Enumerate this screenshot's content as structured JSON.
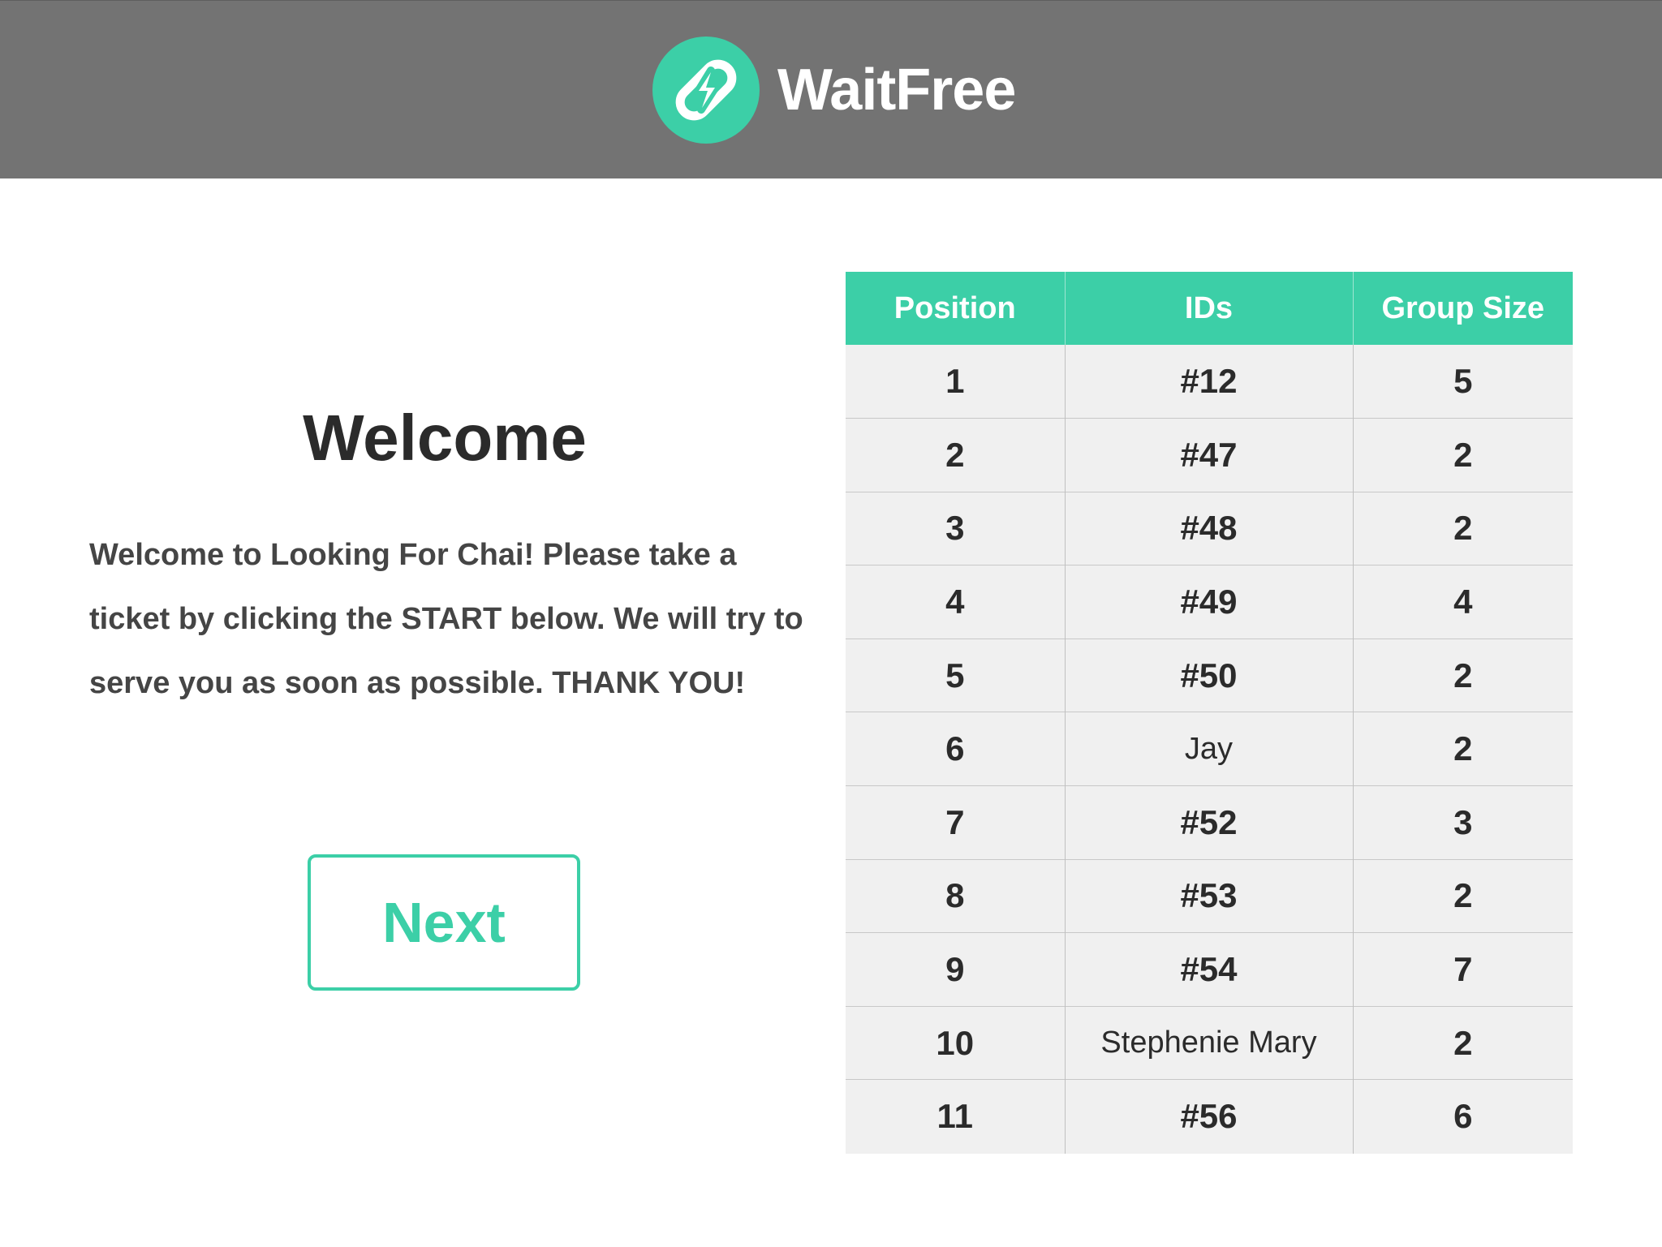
{
  "header": {
    "brand_name": "WaitFree",
    "logo_icon": "link-bolt-icon",
    "accent_color": "#3ccfa7",
    "background_color": "#737373"
  },
  "welcome": {
    "title": "Welcome",
    "message": "Welcome to Looking For Chai! Please take a ticket by clicking the START below. We will try to serve you as soon as possible. THANK YOU!",
    "next_label": "Next"
  },
  "queue": {
    "columns": [
      "Position",
      "IDs",
      "Group Size"
    ],
    "rows": [
      {
        "position": "1",
        "id": "#12",
        "group_size": "5"
      },
      {
        "position": "2",
        "id": "#47",
        "group_size": "2"
      },
      {
        "position": "3",
        "id": "#48",
        "group_size": "2"
      },
      {
        "position": "4",
        "id": "#49",
        "group_size": "4"
      },
      {
        "position": "5",
        "id": "#50",
        "group_size": "2"
      },
      {
        "position": "6",
        "id": "Jay",
        "group_size": "2"
      },
      {
        "position": "7",
        "id": "#52",
        "group_size": "3"
      },
      {
        "position": "8",
        "id": "#53",
        "group_size": "2"
      },
      {
        "position": "9",
        "id": "#54",
        "group_size": "7"
      },
      {
        "position": "10",
        "id": "Stephenie Mary",
        "group_size": "2"
      },
      {
        "position": "11",
        "id": "#56",
        "group_size": "6"
      }
    ]
  }
}
